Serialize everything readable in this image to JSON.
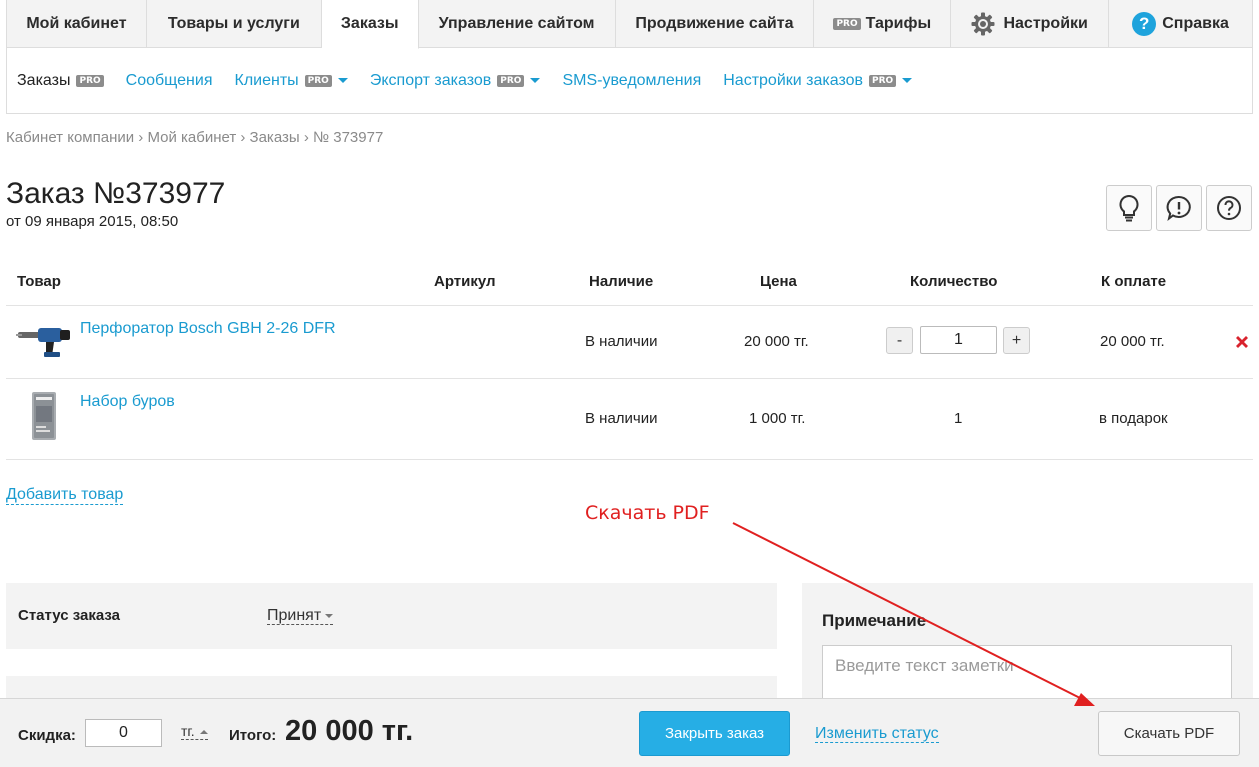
{
  "topnav": {
    "tabs": [
      {
        "label": "Мой кабинет"
      },
      {
        "label": "Товары и услуги"
      },
      {
        "label": "Заказы"
      },
      {
        "label": "Управление сайтом"
      },
      {
        "label": "Продвижение сайта"
      },
      {
        "label": "Тарифы",
        "badge": "PRO"
      },
      {
        "label": "Настройки"
      },
      {
        "label": "Справка",
        "help_glyph": "?"
      }
    ],
    "active_tab": "Заказы"
  },
  "subnav": {
    "items": [
      {
        "label": "Заказы",
        "badge": "PRO"
      },
      {
        "label": "Сообщения"
      },
      {
        "label": "Клиенты",
        "badge": "PRO"
      },
      {
        "label": "Экспорт заказов",
        "badge": "PRO"
      },
      {
        "label": "SMS-уведомления"
      },
      {
        "label": "Настройки заказов",
        "badge": "PRO"
      }
    ]
  },
  "breadcrumb": "Кабинет компании › Мой кабинет › Заказы › № 373977",
  "order": {
    "title": "Заказ №373977",
    "date": "от 09 января 2015, 08:50"
  },
  "icons": [
    "lightbulb-icon",
    "exclamation-icon",
    "question-icon",
    "gear-icon",
    "delete-icon"
  ],
  "table": {
    "headers": {
      "product": "Товар",
      "sku": "Артикул",
      "availability": "Наличие",
      "price": "Цена",
      "quantity": "Количество",
      "to_pay": "К оплате"
    },
    "rows": [
      {
        "name": "Перфоратор Bosch GBH 2-26 DFR",
        "availability": "В наличии",
        "price": "20 000 тг.",
        "qty_minus": "-",
        "quantity": "1",
        "qty_plus": "+",
        "to_pay": "20 000 тг."
      },
      {
        "name": "Набор буров",
        "availability": "В наличии",
        "price": "1 000 тг.",
        "quantity": "1",
        "to_pay": "в подарок"
      }
    ]
  },
  "add_product": "Добавить товар",
  "annotation": "Скачать PDF",
  "status": {
    "label": "Статус заказа",
    "value": "Принят"
  },
  "note": {
    "title": "Примечание",
    "placeholder": "Введите текст заметки"
  },
  "footer": {
    "discount_label": "Скидка:",
    "discount_value": "0",
    "currency": "тг.",
    "total_label": "Итого:",
    "total_value": "20 000 тг.",
    "close_order": "Закрыть заказ",
    "change_status": "Изменить статус",
    "download_pdf": "Скачать PDF"
  },
  "colors": {
    "link": "#1a9bd0",
    "primary_button": "#26aee5",
    "annotation": "#e02020",
    "delete": "#d9232d"
  }
}
